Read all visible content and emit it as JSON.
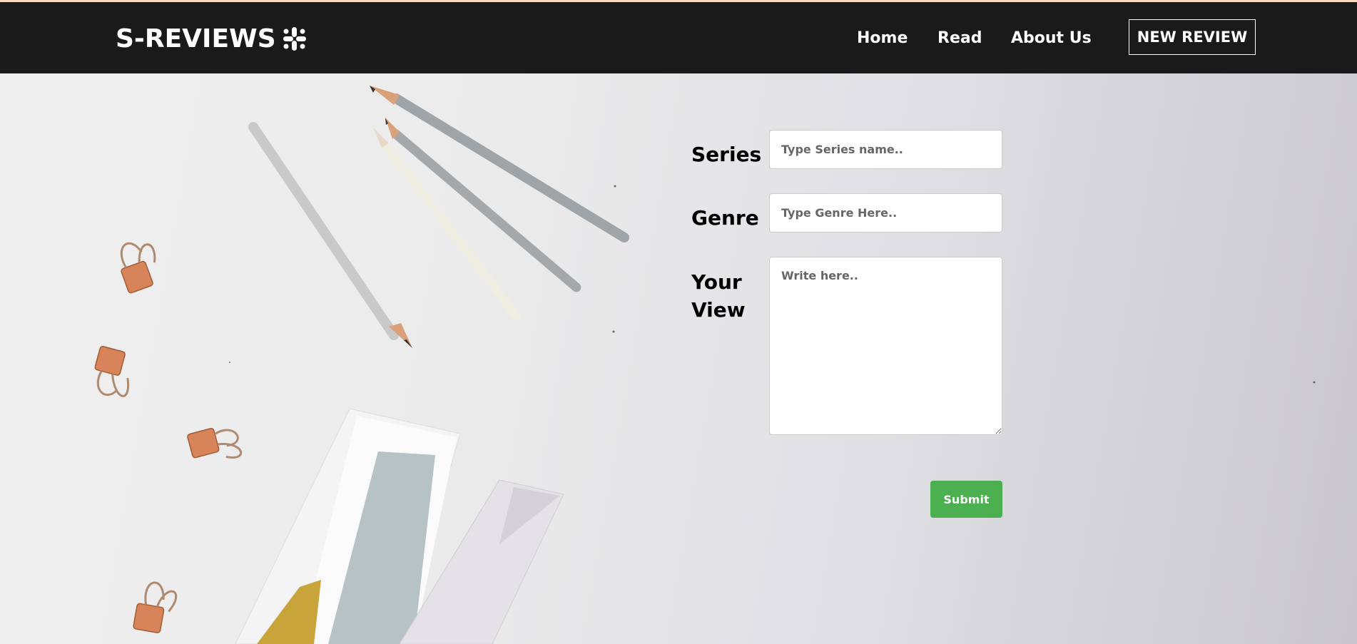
{
  "brand": {
    "name": "S-REVIEWS",
    "logo_icon": "slack-like-hash-icon"
  },
  "nav": {
    "home": "Home",
    "read": "Read",
    "about": "About Us",
    "cta": "NEW REVIEW"
  },
  "form": {
    "series_label": "Series",
    "series_placeholder": "Type Series name..",
    "genre_label": "Genre",
    "genre_placeholder": "Type Genre Here..",
    "view_label": "Your View",
    "view_placeholder": "Write here..",
    "submit_label": "Submit"
  },
  "colors": {
    "navbar": "#1a1a1a",
    "submit": "#4caf50",
    "clips": "#d8845a"
  }
}
